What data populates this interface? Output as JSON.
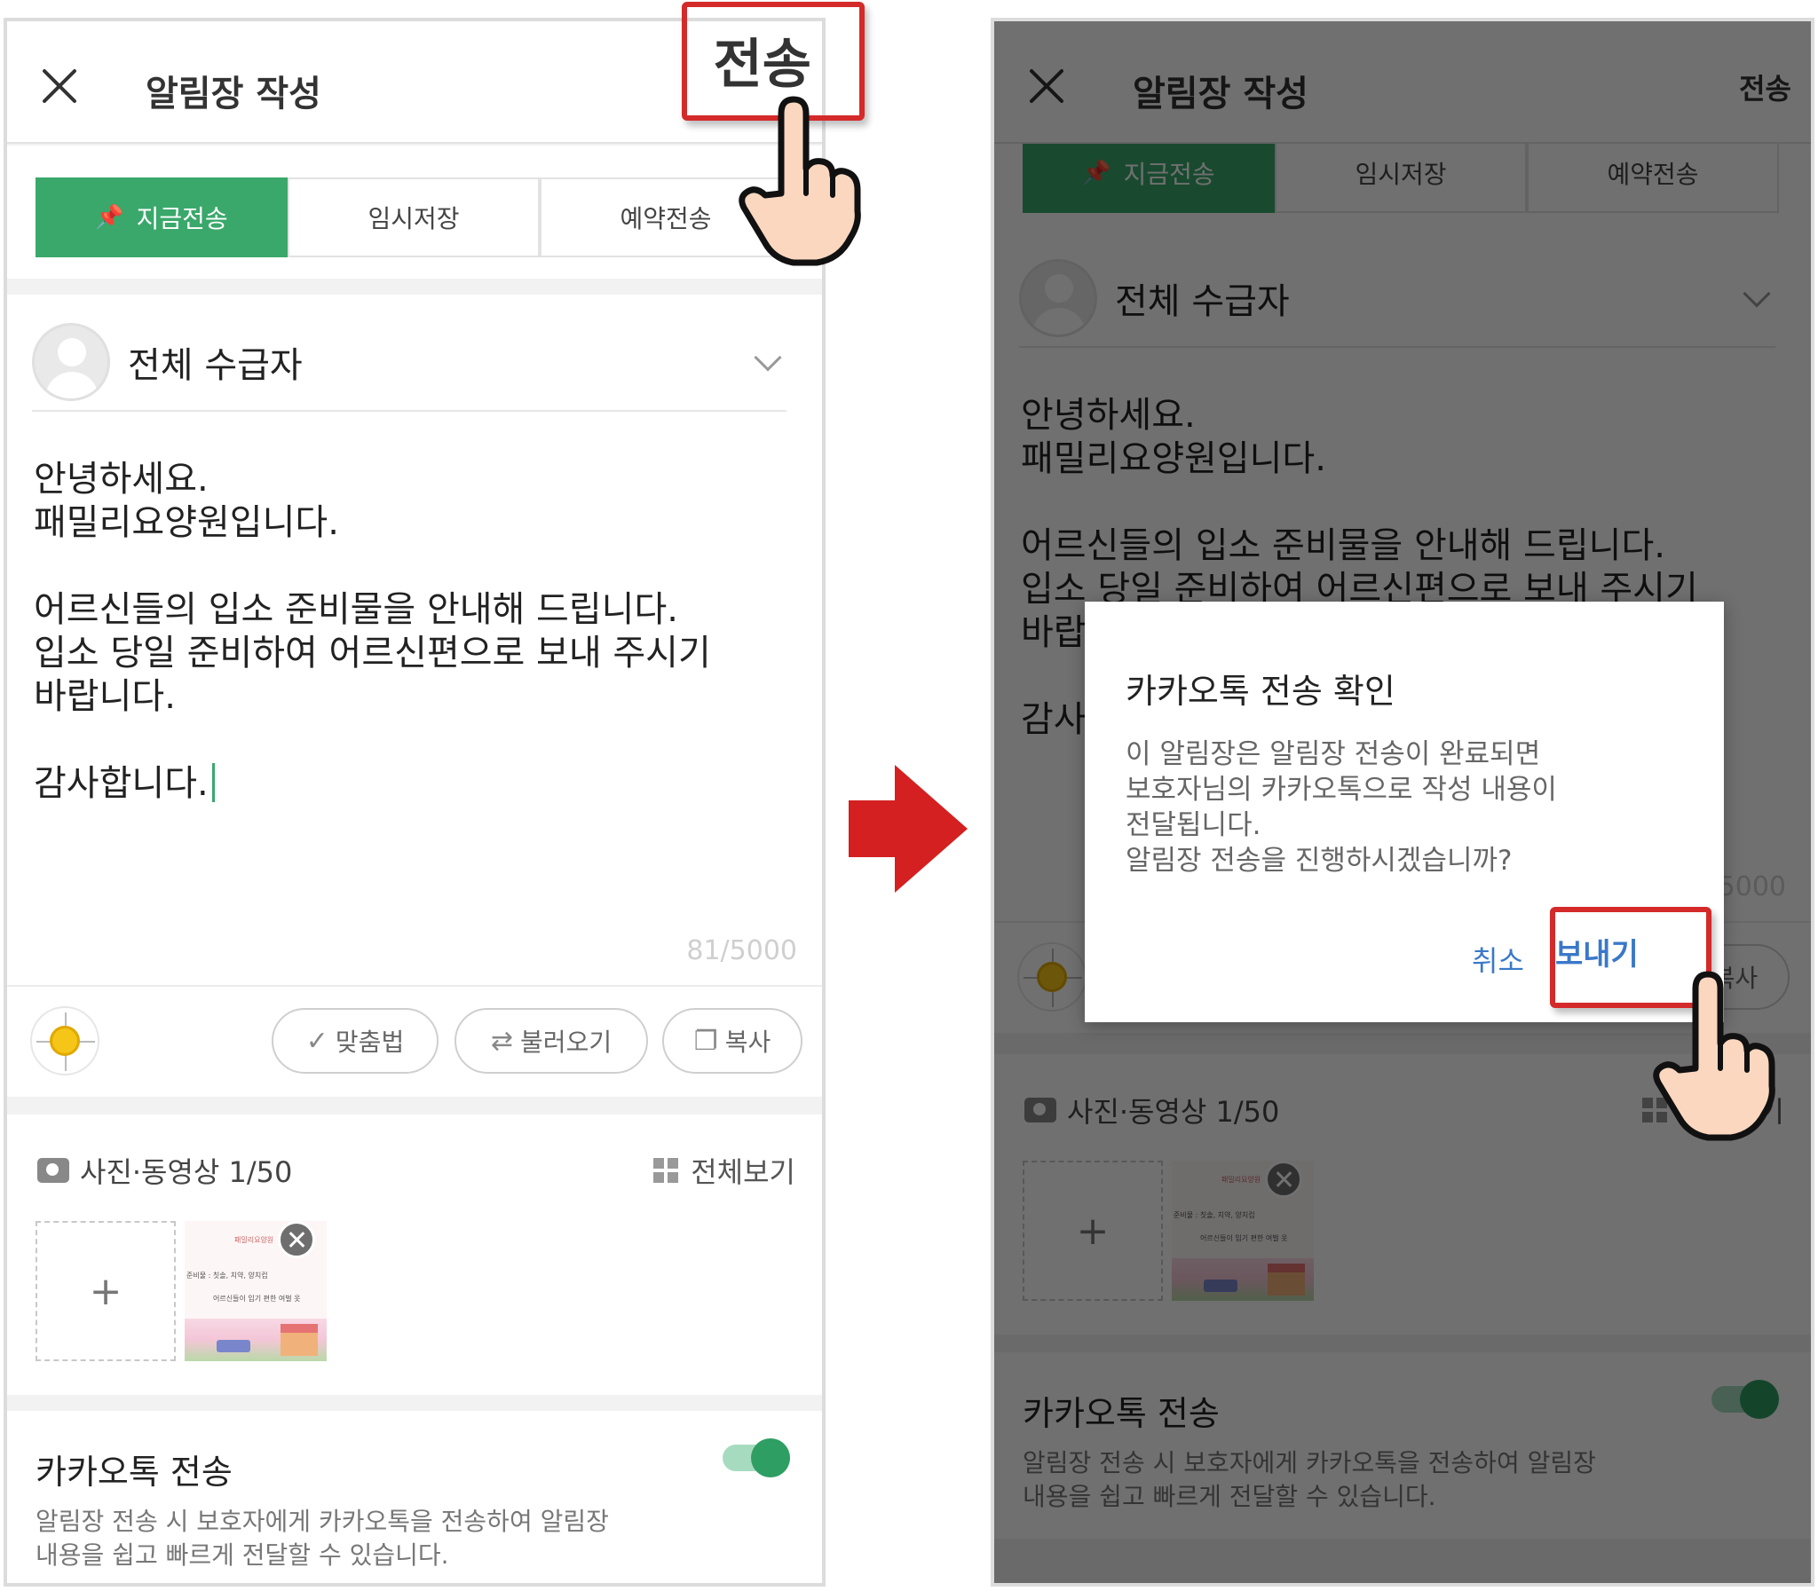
{
  "header": {
    "title": "알림장 작성",
    "send_label": "전송"
  },
  "tabs": [
    {
      "label": "지금전송",
      "active": true
    },
    {
      "label": "임시저장",
      "active": false
    },
    {
      "label": "예약전송",
      "active": false
    }
  ],
  "recipient": {
    "label": "전체 수급자"
  },
  "message": {
    "lines": [
      "안녕하세요.",
      "패밀리요양원입니다.",
      "",
      "어르신들의 입소 준비물을 안내해 드립니다.",
      "입소 당일 준비하여 어르신편으로 보내 주시기",
      "바랍니다.",
      "",
      "감사합니다."
    ],
    "counter": "81/5000"
  },
  "toolbar": {
    "spellcheck": "맞춤법",
    "load": "불러오기",
    "copy": "복사"
  },
  "media": {
    "label": "사진·동영상 1/50",
    "view_all": "전체보기",
    "add": "+",
    "thumb_title": "패밀리요양원",
    "thumb_line1": "준비물 : 칫솔, 치약, 양치컵",
    "thumb_line2": "어르신들이 입기 편한 여벌 옷"
  },
  "kakao": {
    "title": "카카오톡 전송",
    "description_lines": [
      "알림장 전송 시 보호자에게 카카오톡을 전송하여 알림장",
      "내용을 쉽고 빠르게 전달할 수 있습니다."
    ],
    "enabled": true
  },
  "dialog": {
    "title": "카카오톡 전송 확인",
    "body_lines": [
      "이 알림장은 알림장 전송이 완료되면",
      "보호자님의 카카오톡으로 작성 내용이",
      "전달됩니다.",
      "알림장 전송을 진행하시겠습니까?"
    ],
    "cancel": "취소",
    "confirm": "보내기"
  },
  "colors": {
    "accent": "#3aa86b",
    "callout": "#d42a2a",
    "dialog_button": "#3a78c9"
  },
  "icons": [
    "close-icon",
    "pin-icon",
    "avatar-icon",
    "chevron-down-icon",
    "sun-icon",
    "spellcheck-icon",
    "load-icon",
    "copy-icon",
    "camera-icon",
    "grid-icon",
    "remove-icon",
    "pointing-hand-icon",
    "arrow-right-icon"
  ]
}
